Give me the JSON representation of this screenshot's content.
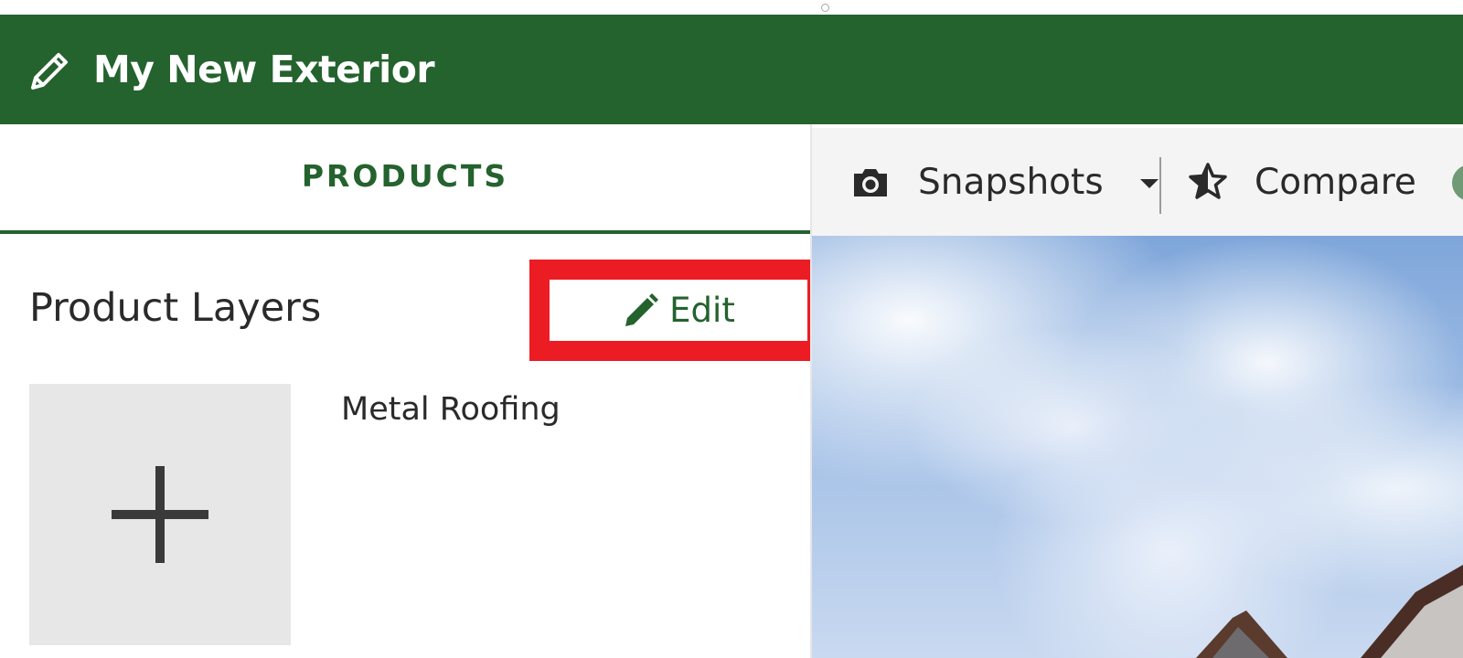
{
  "header": {
    "title": "My New Exterior",
    "background": "#24622e",
    "icon": "pencil-icon"
  },
  "left_panel": {
    "tab": {
      "label": "PRODUCTS",
      "active": true
    },
    "section_title": "Product Layers",
    "edit_button": {
      "label": "Edit",
      "icon": "pencil-icon",
      "highlight_color": "#ec1c24"
    },
    "add_tile": {
      "icon": "plus-icon"
    },
    "layers": [
      {
        "name": "Metal Roofing"
      }
    ]
  },
  "toolbar": {
    "snapshots": {
      "label": "Snapshots",
      "icon": "camera-icon"
    },
    "compare": {
      "label": "Compare",
      "icon": "star-icon"
    }
  },
  "colors": {
    "accent_green": "#24622e",
    "text": "#2a2a2a",
    "highlight_red": "#ec1c24"
  }
}
